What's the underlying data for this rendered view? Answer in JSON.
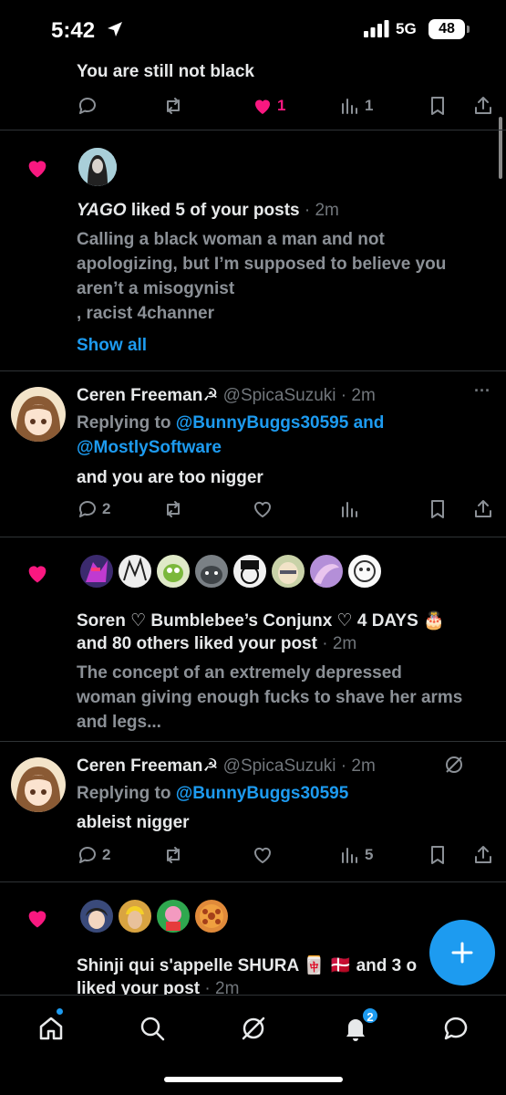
{
  "status": {
    "time": "5:42",
    "network": "5G",
    "battery": "48"
  },
  "top_reply": {
    "text": "You are still not black",
    "like_count": "1",
    "view_count": "1"
  },
  "notif1": {
    "name": "YAGO",
    "action": " liked 5 of your posts",
    "time": " · 2m",
    "lines": [
      "Calling a black woman a man and not",
      "apologizing, but I’m supposed to believe you",
      "aren’t a misogynist",
      ", racist 4channer"
    ],
    "show_all": "Show all"
  },
  "reply1": {
    "name": "Ceren Freeman☭",
    "handle": " @SpicaSuzuki",
    "time": " · 2m",
    "replying_prefix": "Replying to ",
    "replying_to_1": "@BunnyBuggs30595",
    "replying_and": " and",
    "replying_to_2": "@MostlySoftware",
    "text": "and you are too nigger",
    "reply_count": "2",
    "more": "···"
  },
  "notif2": {
    "line1": "Soren ♡ Bumblebee’s Conjunx ♡ 4 DAYS 🎂",
    "line2_prefix": "and 80 others liked your post",
    "time": " · 2m",
    "lines": [
      "The concept of an extremely depressed",
      "woman giving enough fucks to shave her arms",
      "and legs..."
    ]
  },
  "reply2": {
    "name": "Ceren Freeman☭",
    "handle": " @SpicaSuzuki",
    "time": " · 2m",
    "replying_prefix": "Replying to ",
    "replying_to": "@BunnyBuggs30595",
    "text": "ableist nigger",
    "reply_count": "2",
    "view_count": "5"
  },
  "notif3": {
    "line1": "Shinji qui s'appelle SHURA 🀄 🇩🇰 and 3 o",
    "line2": "liked your post",
    "time": " · 2m"
  },
  "nav": {
    "notifications_badge": "2"
  },
  "colors": {
    "accent": "#1d9bf0",
    "like": "#f91880",
    "text": "#e7e9ea",
    "muted": "#71767b"
  }
}
